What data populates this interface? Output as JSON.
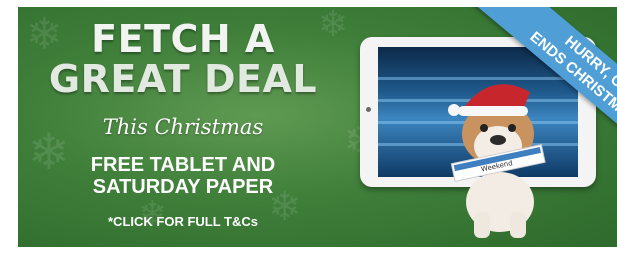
{
  "banner": {
    "headline_line1": "FETCH A",
    "headline_line2": "GREAT DEAL",
    "script_line": "This Christmas",
    "offer_line1": "FREE TABLET AND",
    "offer_line2": "SATURDAY PAPER",
    "terms_link": "*CLICK FOR FULL T&Cs",
    "ribbon_line1": "HURRY, OFFER",
    "ribbon_line2": "ENDS CHRISTMAS EVE",
    "newspaper_masthead": "Weekend"
  },
  "colors": {
    "background_green": "#3f7f3a",
    "ribbon_blue": "#4f9fd6",
    "santa_hat_red": "#c8262d",
    "text_white": "#ffffff"
  },
  "icons": {
    "decoration": "snowflake-icon",
    "mascot": "bulldog-in-santa-hat"
  }
}
